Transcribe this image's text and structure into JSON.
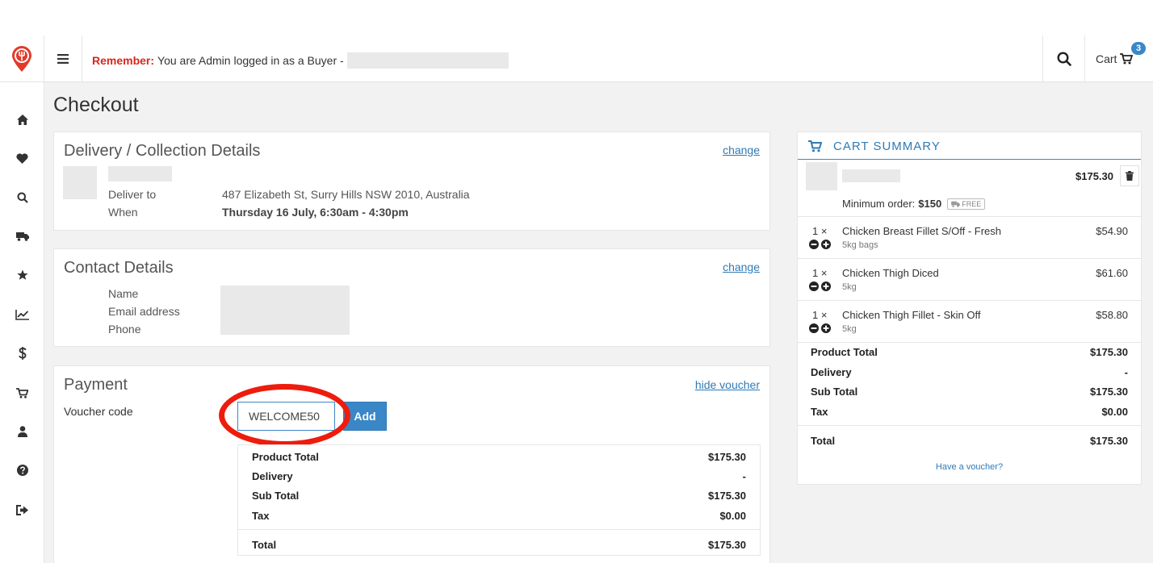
{
  "header": {
    "remember_label": "Remember:",
    "remember_text": "You are Admin logged in as a Buyer -",
    "cart_label": "Cart",
    "cart_count": "3"
  },
  "sidebar": {
    "items": [
      {
        "icon": "home-icon"
      },
      {
        "icon": "heart-icon"
      },
      {
        "icon": "search-icon"
      },
      {
        "icon": "truck-icon"
      },
      {
        "icon": "star-icon"
      },
      {
        "icon": "chart-icon"
      },
      {
        "icon": "dollar-icon"
      },
      {
        "icon": "cart-icon"
      },
      {
        "icon": "user-icon"
      },
      {
        "icon": "help-icon"
      },
      {
        "icon": "logout-icon"
      }
    ]
  },
  "page": {
    "title": "Checkout"
  },
  "delivery": {
    "title": "Delivery / Collection Details",
    "change_label": "change",
    "deliver_to_label": "Deliver to",
    "deliver_to_value": "487 Elizabeth St, Surry Hills NSW 2010, Australia",
    "when_label": "When",
    "when_value": "Thursday 16 July, 6:30am - 4:30pm"
  },
  "contact": {
    "title": "Contact Details",
    "change_label": "change",
    "name_label": "Name",
    "email_label": "Email address",
    "phone_label": "Phone"
  },
  "payment": {
    "title": "Payment",
    "hide_voucher_label": "hide voucher",
    "voucher_label": "Voucher code",
    "voucher_value": "WELCOME50",
    "add_label": "Add",
    "totals": [
      {
        "label": "Product Total",
        "value": "$175.30"
      },
      {
        "label": "Delivery",
        "value": "-"
      },
      {
        "label": "Sub Total",
        "value": "$175.30"
      },
      {
        "label": "Tax",
        "value": "$0.00"
      }
    ],
    "total_label": "Total",
    "total_value": "$175.30"
  },
  "cart_summary": {
    "title": "CART SUMMARY",
    "supplier_total": "$175.30",
    "minimum_order_label": "Minimum order:",
    "minimum_order_value": "$150",
    "free_label": "FREE",
    "items": [
      {
        "qty": "1 ×",
        "name": "Chicken Breast Fillet S/Off - Fresh",
        "sub": "5kg bags",
        "price": "$54.90"
      },
      {
        "qty": "1 ×",
        "name": "Chicken Thigh Diced",
        "sub": "5kg",
        "price": "$61.60"
      },
      {
        "qty": "1 ×",
        "name": "Chicken Thigh Fillet - Skin Off",
        "sub": "5kg",
        "price": "$58.80"
      }
    ],
    "totals": [
      {
        "label": "Product Total",
        "value": "$175.30"
      },
      {
        "label": "Delivery",
        "value": "-"
      },
      {
        "label": "Sub Total",
        "value": "$175.30"
      },
      {
        "label": "Tax",
        "value": "$0.00"
      }
    ],
    "total_label": "Total",
    "total_value": "$175.30",
    "voucher_link": "Have a voucher?"
  },
  "colors": {
    "accent": "#3a87c8",
    "alert": "#d9261c",
    "highlight": "#ee1c0c"
  }
}
